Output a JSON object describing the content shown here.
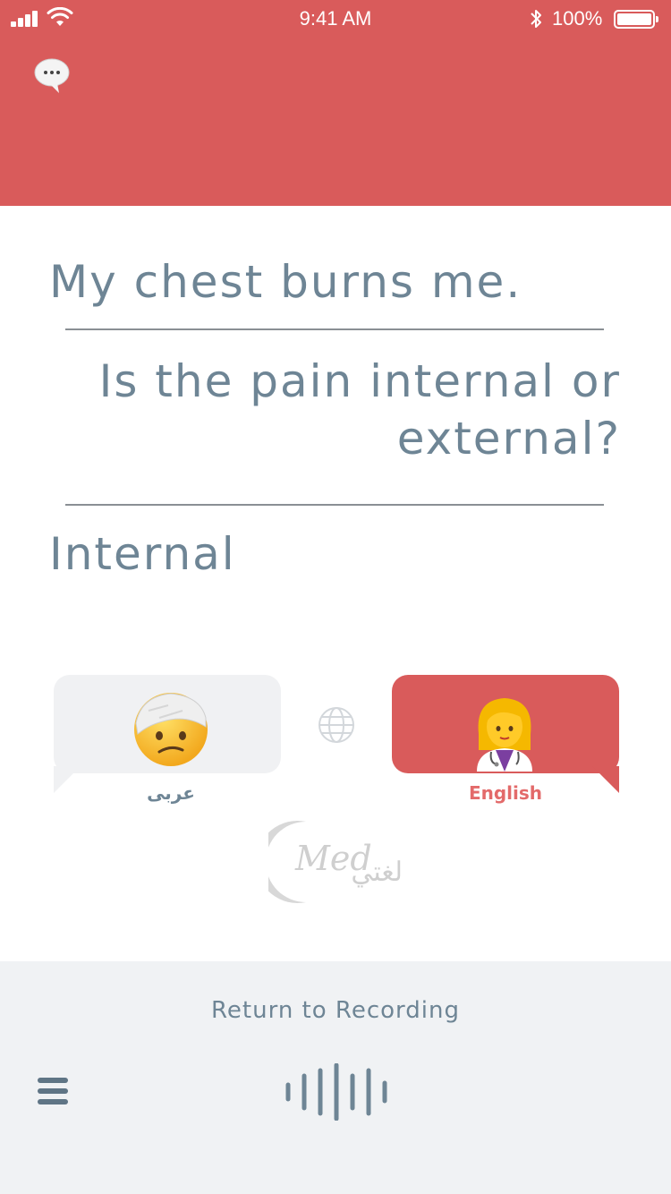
{
  "status_bar": {
    "time": "9:41 AM",
    "battery_percent": "100%"
  },
  "header": {
    "chat_icon": "chat-bubble-icon",
    "color": "#d95b5b"
  },
  "transcript": {
    "lines": [
      "My chest burns me.",
      "Is the pain internal or external?",
      "Internal"
    ]
  },
  "speakers": {
    "left": {
      "language": "عربى",
      "emoji": "face-with-head-bandage-icon"
    },
    "right": {
      "language": "English",
      "emoji": "woman-health-worker-icon",
      "active": true
    },
    "switch_icon": "globe-icon"
  },
  "logo": {
    "text": "Med",
    "arabic": "لغتي"
  },
  "footer": {
    "return_label": "Return to Recording",
    "menu_icon": "menu-icon",
    "record_icon": "waveform-icon"
  }
}
